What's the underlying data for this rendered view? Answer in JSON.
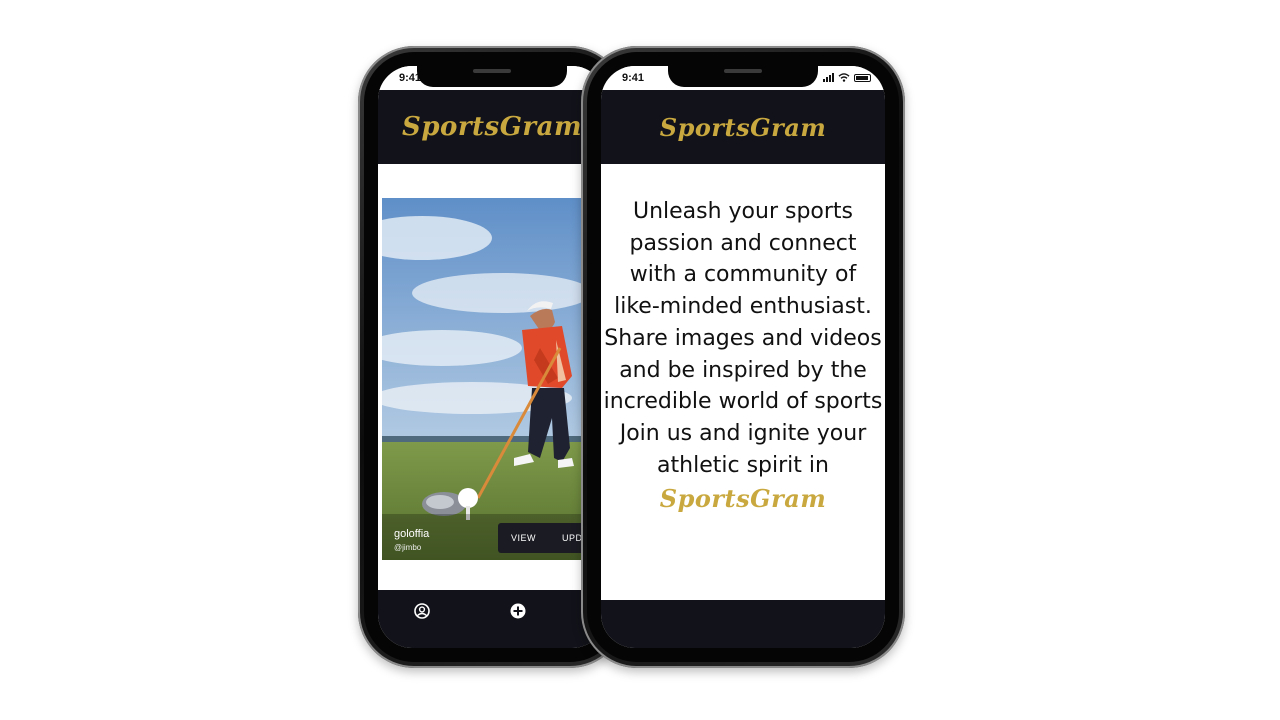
{
  "app": {
    "brand": "SportsGram",
    "accent_color": "#c9a93f",
    "bar_color": "#12131a"
  },
  "status_bar": {
    "time": "9:41",
    "icons": [
      "signal-icon",
      "wifi-icon",
      "battery-icon"
    ]
  },
  "feed_screen": {
    "post": {
      "username": "goloffia",
      "handle": "@jimbo",
      "actions": [
        "VIEW",
        "UPDATE"
      ]
    },
    "nav_icons": [
      "profile-icon",
      "add-icon"
    ]
  },
  "welcome_screen": {
    "lines": [
      "Unleash your sports",
      "passion and connect",
      "with a community of",
      "like-minded enthusiast.",
      "Share images and videos",
      "and be inspired by the",
      "incredible world of sports",
      "Join us and ignite your",
      "athletic spirit in"
    ],
    "brand": "SportsGram"
  }
}
